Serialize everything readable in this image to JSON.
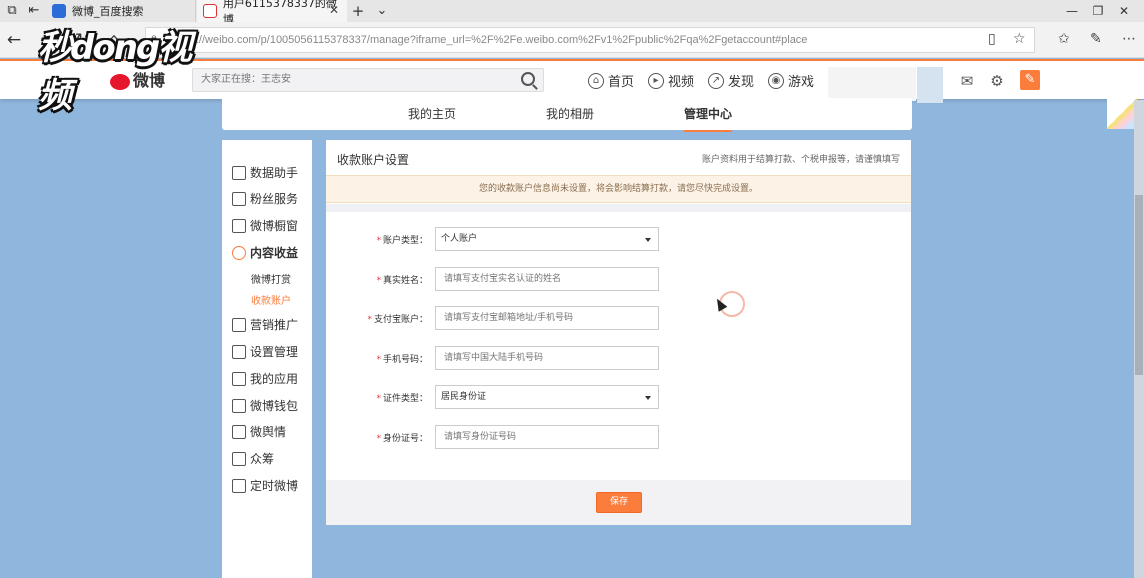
{
  "browser": {
    "tabs": [
      {
        "title": "微博_百度搜索",
        "active": false
      },
      {
        "title": "用户6115378337的微博",
        "active": true
      }
    ],
    "new_tab_glyph": "+",
    "url": "https://weibo.com/p/1005056115378337/manage?iframe_url=%2F%2Fe.weibo.com%2Fv1%2Fpublic%2Fqa%2Fgetaccount#place"
  },
  "watermark": {
    "text": "秒dong视频"
  },
  "weibo_header": {
    "logo_text": "微博",
    "search_placeholder": "大家正在搜：王志安",
    "nav": [
      {
        "label": "首页",
        "icon": "home-icon"
      },
      {
        "label": "视频",
        "icon": "video-icon"
      },
      {
        "label": "发现",
        "icon": "compass-icon"
      },
      {
        "label": "游戏",
        "icon": "game-icon"
      }
    ],
    "accent_color": "#fa7d3c"
  },
  "profile_tabs": [
    {
      "label": "我的主页",
      "active": false
    },
    {
      "label": "我的相册",
      "active": false
    },
    {
      "label": "管理中心",
      "active": true
    }
  ],
  "sidebar": {
    "items": [
      {
        "label": "数据助手",
        "icon": "chart-line-icon"
      },
      {
        "label": "粉丝服务",
        "icon": "fans-icon"
      },
      {
        "label": "微博橱窗",
        "icon": "shop-icon"
      },
      {
        "label": "内容收益",
        "icon": "income-icon",
        "active": true
      },
      {
        "label": "营销推广",
        "icon": "bag-icon"
      },
      {
        "label": "设置管理",
        "icon": "user-settings-icon"
      },
      {
        "label": "我的应用",
        "icon": "apps-icon"
      },
      {
        "label": "微博钱包",
        "icon": "wallet-icon"
      },
      {
        "label": "微舆情",
        "icon": "opinion-icon"
      },
      {
        "label": "众筹",
        "icon": "crowdfund-icon"
      },
      {
        "label": "定时微博",
        "icon": "clock-icon"
      }
    ],
    "sub_items": [
      {
        "label": "微博打赏",
        "current": false
      },
      {
        "label": "收款账户",
        "current": true
      }
    ]
  },
  "main": {
    "title": "收款账户设置",
    "note": "账户资料用于结算打款、个税申报等，请谨慎填写",
    "warning": "您的收款账户信息尚未设置，将会影响结算打款，请您尽快完成设置。",
    "required_mark": "*",
    "fields": [
      {
        "label": "账户类型：",
        "type": "select",
        "value": "个人账户"
      },
      {
        "label": "真实姓名：",
        "type": "input",
        "placeholder": "请填写支付宝实名认证的姓名"
      },
      {
        "label": "支付宝账户：",
        "type": "input",
        "placeholder": "请填写支付宝邮箱地址/手机号码"
      },
      {
        "label": "手机号码：",
        "type": "input",
        "placeholder": "请填写中国大陆手机号码"
      },
      {
        "label": "证件类型：",
        "type": "select",
        "value": "居民身份证"
      },
      {
        "label": "身份证号：",
        "type": "input",
        "placeholder": "请填写身份证号码"
      }
    ],
    "save_label": "保存"
  }
}
